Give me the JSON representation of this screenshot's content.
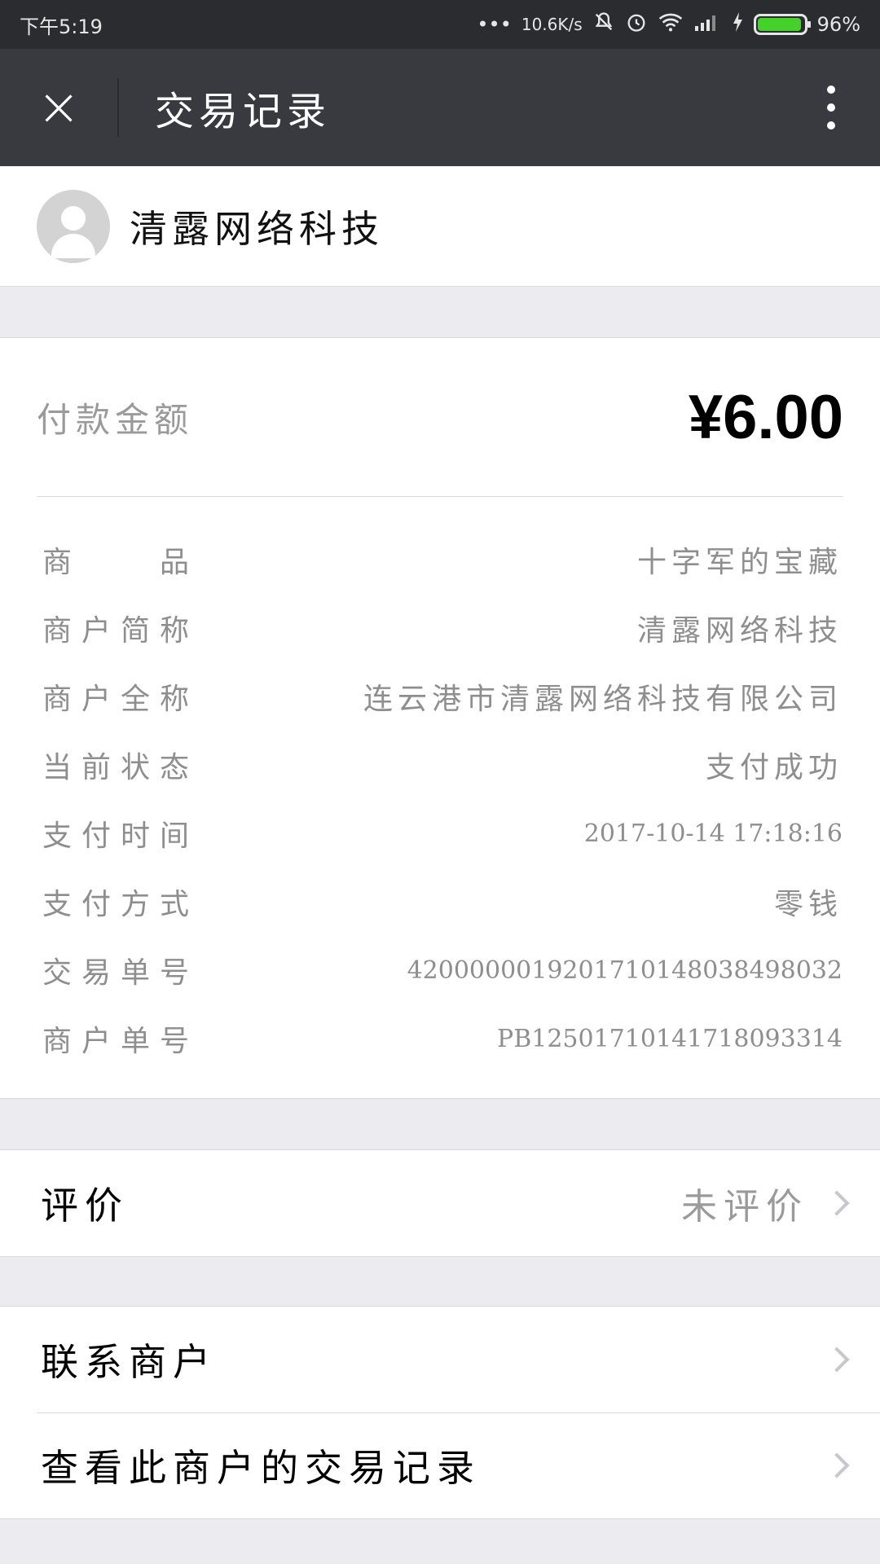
{
  "status_bar": {
    "time": "下午5:19",
    "dots": "•••",
    "network_speed": "10.6K/s",
    "battery_percent": "96%",
    "battery_level": 0.96
  },
  "nav": {
    "close_icon": "×",
    "title": "交易记录"
  },
  "merchant": {
    "name": "清露网络科技"
  },
  "payment": {
    "amount_label": "付款金额",
    "amount": "¥6.00"
  },
  "details": [
    {
      "label": "商　　品",
      "value": "十字军的宝藏"
    },
    {
      "label": "商户简称",
      "value": "清露网络科技"
    },
    {
      "label": "商户全称",
      "value": "连云港市清露网络科技有限公司"
    },
    {
      "label": "当前状态",
      "value": "支付成功"
    },
    {
      "label": "支付时间",
      "value": "2017-10-14 17:18:16"
    },
    {
      "label": "支付方式",
      "value": "零钱"
    },
    {
      "label": "交易单号",
      "value": "4200000019201710148038498032"
    },
    {
      "label": "商户单号",
      "value": "PB12501710141718093314"
    }
  ],
  "review": {
    "label": "评价",
    "value": "未评价"
  },
  "actions": {
    "contact_merchant": "联系商户",
    "view_merchant_records": "查看此商户的交易记录"
  },
  "icons": {
    "close": "close-icon",
    "more": "more-vertical-icon",
    "chevron": "chevron-right-icon",
    "avatar": "user-avatar-icon"
  },
  "colors": {
    "status_bar": "#2b2c30",
    "nav_bar": "#393a3f",
    "background": "#ebebf0",
    "battery": "#43d12a",
    "muted_text": "#8e8e8e"
  }
}
